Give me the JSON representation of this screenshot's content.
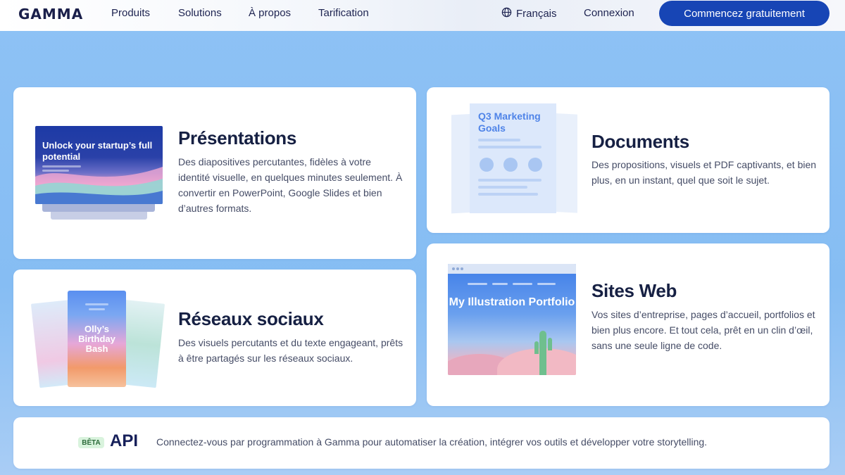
{
  "nav": {
    "logo": "GAMMA",
    "links": [
      "Produits",
      "Solutions",
      "À propos",
      "Tarification"
    ],
    "language": "Français",
    "login": "Connexion",
    "cta": "Commencez gratuitement",
    "icons": {
      "language": "globe-icon"
    }
  },
  "cards": {
    "presentations": {
      "title": "Présentations",
      "description": "Des diapositives percutantes, fidèles à votre identité visuelle, en quelques minutes seulement. À convertir en PowerPoint, Google Slides et bien d’autres formats.",
      "illustration_text": "Unlock your startup’s full potential"
    },
    "documents": {
      "title": "Documents",
      "description": "Des propositions, visuels et PDF captivants, et bien plus, en un instant, quel que soit le sujet.",
      "illustration_text": "Q3 Marketing Goals"
    },
    "social": {
      "title": "Réseaux sociaux",
      "description": "Des visuels percutants et du texte engageant, prêts à être partagés sur les réseaux sociaux.",
      "illustration_text": "Olly’s Birthday Bash"
    },
    "websites": {
      "title": "Sites Web",
      "description": "Vos sites d’entreprise, pages d’accueil, portfolios et bien plus encore. Et tout cela, prêt en un clin d’œil, sans une seule ligne de code.",
      "illustration_text": "My Illustration Portfolio"
    }
  },
  "api": {
    "badge": "BÊTA",
    "title": "API",
    "description": "Connectez-vous par programmation à Gamma pour automatiser la création, intégrer vos outils et développer votre storytelling."
  },
  "colors": {
    "accent": "#1745b5",
    "background": "#86bdf3",
    "title": "#162043",
    "badge_bg": "#d9f3dd"
  }
}
